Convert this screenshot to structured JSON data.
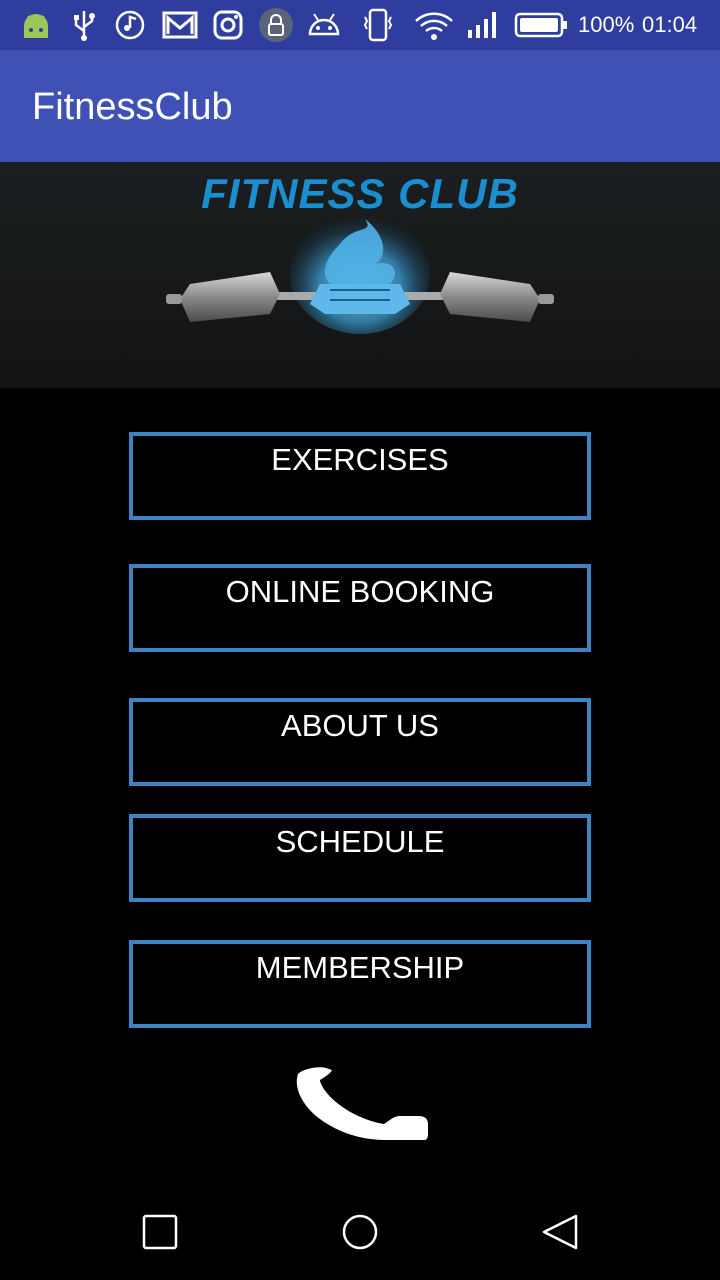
{
  "status_bar": {
    "battery_percent": "100%",
    "time": "01:04",
    "icons": [
      "android-icon",
      "usb-icon",
      "bluetooth-music-icon",
      "gmail-icon",
      "instagram-icon",
      "lock-icon",
      "android-debug-icon",
      "vibrate-icon",
      "wifi-icon",
      "signal-icon",
      "battery-icon"
    ]
  },
  "app_bar": {
    "title": "FitnessClub"
  },
  "banner": {
    "title": "FITNESS CLUB"
  },
  "menu": {
    "items": [
      {
        "label": "EXERCISES"
      },
      {
        "label": "ONLINE BOOKING"
      },
      {
        "label": "ABOUT US"
      },
      {
        "label": "SCHEDULE"
      },
      {
        "label": "MEMBERSHIP"
      }
    ]
  },
  "call": {
    "icon": "phone-icon"
  },
  "nav_bar": {
    "icons": [
      "recents-icon",
      "home-icon",
      "back-icon"
    ]
  },
  "colors": {
    "app_bar": "#3f51b5",
    "status_bar": "#2f3e9e",
    "button_border": "#3d84c4",
    "banner_title": "#1a8fd0"
  }
}
